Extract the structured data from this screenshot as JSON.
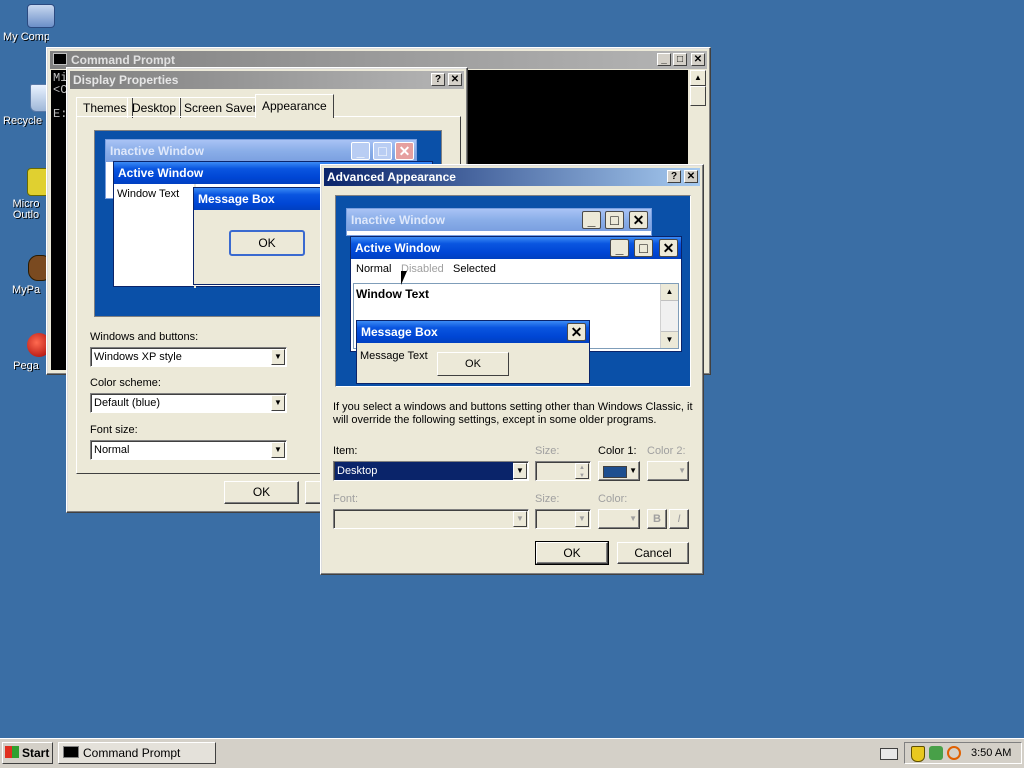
{
  "desktop": {
    "icons": [
      {
        "label": "My Computer"
      },
      {
        "label": "Recycle Bin"
      },
      {
        "label": "Microsoft Outlook"
      },
      {
        "label": "MyPal"
      },
      {
        "label": "Pegasus"
      }
    ]
  },
  "cmd": {
    "title": "Command Prompt",
    "lines": [
      "Mi",
      "<C",
      "E:"
    ]
  },
  "display_props": {
    "title": "Display Properties",
    "tabs": [
      "Themes",
      "Desktop",
      "Screen Saver",
      "Appearance"
    ],
    "preview": {
      "inactive_title": "Inactive Window",
      "active_title": "Active Window",
      "window_text": "Window Text",
      "msgbox_title": "Message Box",
      "ok_label": "OK"
    },
    "windows_buttons_label": "Windows and buttons:",
    "windows_buttons_value": "Windows XP style",
    "color_scheme_label": "Color scheme:",
    "color_scheme_value": "Default (blue)",
    "font_size_label": "Font size:",
    "font_size_value": "Normal",
    "ok_label": "OK"
  },
  "adv": {
    "title": "Advanced Appearance",
    "preview": {
      "inactive_title": "Inactive Window",
      "active_title": "Active Window",
      "menu_normal": "Normal",
      "menu_disabled": "Disabled",
      "menu_selected": "Selected",
      "window_text": "Window Text",
      "msgbox_title": "Message Box",
      "msgbox_text": "Message Text",
      "ok_label": "OK"
    },
    "info_text": "If you select a windows and buttons setting other than Windows Classic, it will override the following settings, except in some older programs.",
    "item_label": "Item:",
    "item_value": "Desktop",
    "size_label": "Size:",
    "color1_label": "Color 1:",
    "color2_label": "Color 2:",
    "font_label": "Font:",
    "font_size_label": "Size:",
    "font_color_label": "Color:",
    "bold_label": "B",
    "italic_label": "I",
    "ok_label": "OK",
    "cancel_label": "Cancel",
    "color1_value": "#1e4f8f"
  },
  "taskbar": {
    "start_label": "Start",
    "task_label": "Command Prompt",
    "clock": "3:50 AM"
  },
  "colors": {
    "desktop": "#3a6ea5",
    "preview_desktop": "#0a50a8",
    "selection": "#0a246a"
  }
}
